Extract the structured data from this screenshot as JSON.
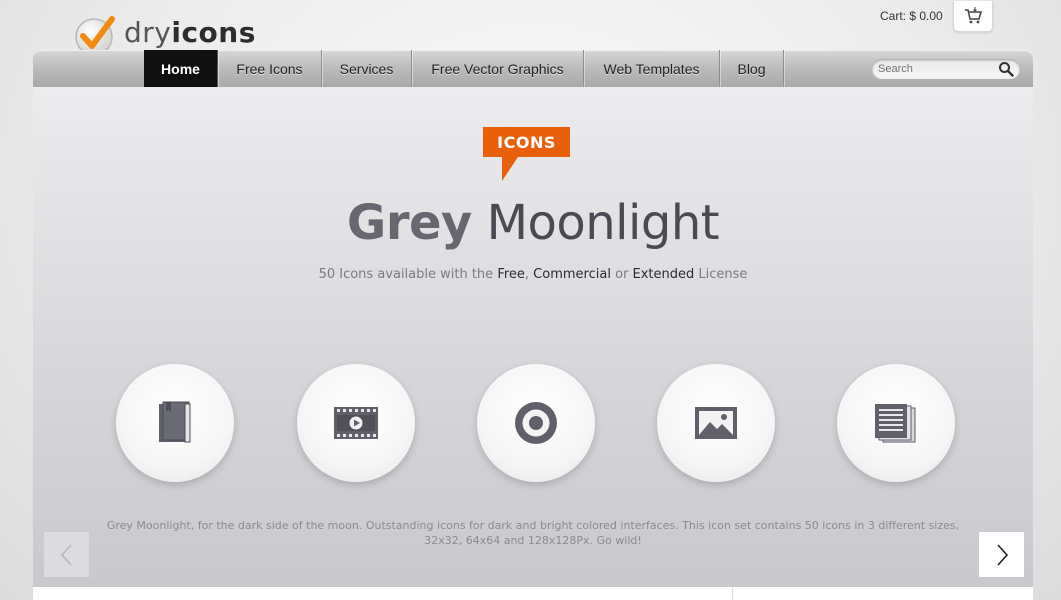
{
  "brand": {
    "name_light": "dry",
    "name_bold": "icons"
  },
  "cart": {
    "label": "Cart: $ 0.00"
  },
  "nav": {
    "items": [
      {
        "label": "Home",
        "active": true
      },
      {
        "label": "Free Icons"
      },
      {
        "label": "Services"
      },
      {
        "label": "Free Vector Graphics"
      },
      {
        "label": "Web Templates"
      },
      {
        "label": "Blog"
      }
    ]
  },
  "search": {
    "placeholder": "Search"
  },
  "hero": {
    "badge": "ICONS",
    "title_bold": "Grey",
    "title_light": " Moonlight",
    "subtitle": {
      "prefix": "50 Icons available with the ",
      "free": "Free",
      "sep1": ", ",
      "commercial": "Commercial",
      "sep2": " or ",
      "extended": "Extended",
      "suffix": " License"
    },
    "icons": [
      "book-icon",
      "video-icon",
      "target-icon",
      "image-icon",
      "document-icon"
    ],
    "description": "Grey Moonlight, for the dark side of the moon. Outstanding icons for dark and bright colored interfaces. This icon set contains 50 icons in 3 different sizes, 32x32, 64x64 and 128x128Px. Go wild!"
  },
  "colors": {
    "accent": "#e8600a",
    "icon_fill": "#5f6069",
    "nav_active": "#101010"
  }
}
